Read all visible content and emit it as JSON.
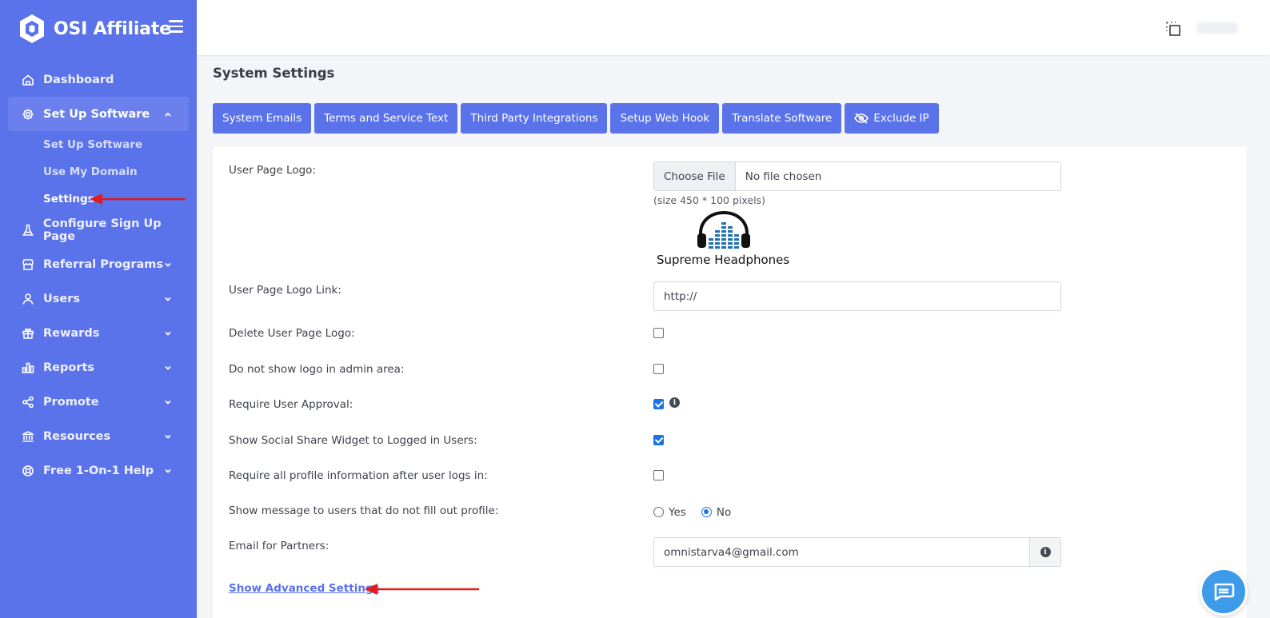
{
  "brand": {
    "name": "OSI Affiliate"
  },
  "sidebar": {
    "items": [
      {
        "label": "Dashboard",
        "icon": "home-icon"
      },
      {
        "label": "Set Up Software",
        "icon": "gear-icon",
        "expanded": true,
        "children": [
          {
            "label": "Set Up Software"
          },
          {
            "label": "Use My Domain"
          },
          {
            "label": "Settings",
            "current": true
          }
        ]
      },
      {
        "label": "Configure Sign Up Page",
        "icon": "flask-icon"
      },
      {
        "label": "Referral Programs",
        "icon": "store-icon"
      },
      {
        "label": "Users",
        "icon": "user-icon"
      },
      {
        "label": "Rewards",
        "icon": "gift-icon"
      },
      {
        "label": "Reports",
        "icon": "bar-chart-icon"
      },
      {
        "label": "Promote",
        "icon": "share-icon"
      },
      {
        "label": "Resources",
        "icon": "bank-icon"
      },
      {
        "label": "Free 1-On-1 Help",
        "icon": "lifebuoy-icon"
      }
    ]
  },
  "page": {
    "title": "System Settings"
  },
  "tabs": [
    {
      "label": "System Emails"
    },
    {
      "label": "Terms and Service Text"
    },
    {
      "label": "Third Party Integrations"
    },
    {
      "label": "Setup Web Hook"
    },
    {
      "label": "Translate Software"
    },
    {
      "label": "Exclude IP",
      "icon": "eye-slash-icon"
    }
  ],
  "form": {
    "logo": {
      "label": "User Page Logo:",
      "button": "Choose File",
      "file_name": "No file chosen",
      "hint": "(size 450 * 100 pixels)",
      "preview_text": "Supreme Headphones"
    },
    "logo_link": {
      "label": "User Page Logo Link:",
      "value": "http://"
    },
    "delete_logo": {
      "label": "Delete User Page Logo:",
      "checked": false
    },
    "hide_logo_admin": {
      "label": "Do not show logo in admin area:",
      "checked": false
    },
    "require_approval": {
      "label": "Require User Approval:",
      "checked": true
    },
    "social_share": {
      "label": "Show Social Share Widget to Logged in Users:",
      "checked": true
    },
    "require_profile": {
      "label": "Require all profile information after user logs in:",
      "checked": false
    },
    "show_message": {
      "label": "Show message to users that do not fill out profile:",
      "options": [
        "Yes",
        "No"
      ],
      "selected": "No"
    },
    "partner_email": {
      "label": "Email for Partners:",
      "value": "omnistarva4@gmail.com"
    },
    "advanced_link": "Show Advanced Settings"
  },
  "colors": {
    "sidebar": "#5a72ea",
    "accent": "#5a72ea",
    "checkbox": "#1a73e8",
    "annotation_arrow": "#e21b1b"
  }
}
